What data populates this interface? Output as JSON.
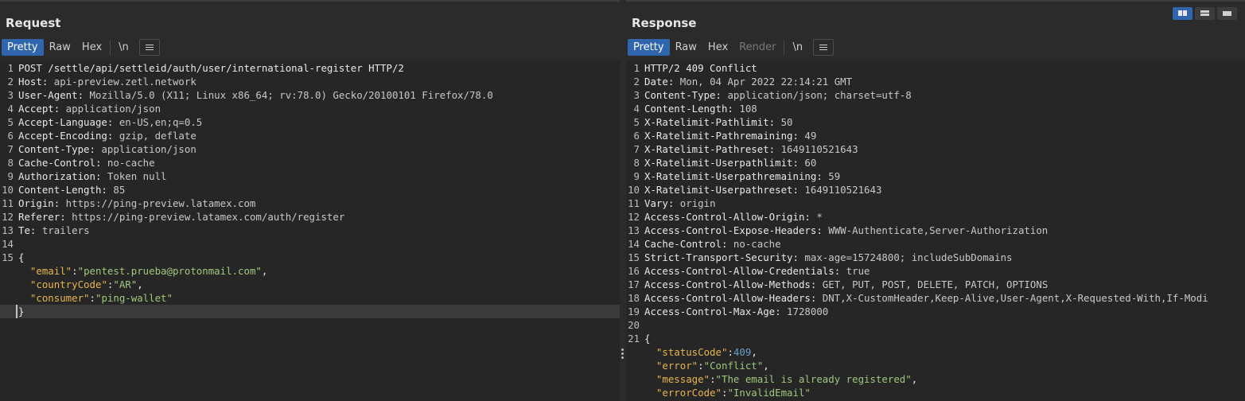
{
  "request": {
    "title": "Request",
    "tabs": [
      "Pretty",
      "Raw",
      "Hex"
    ],
    "newline_label": "\\n",
    "menu_icon": "hamburger-icon",
    "lines": [
      {
        "num": "1",
        "key": "POST /settle/api/settleid/auth/user/international-register HTTP/2",
        "val": ""
      },
      {
        "num": "2",
        "key": "Host:",
        "val": " api-preview.zetl.network"
      },
      {
        "num": "3",
        "key": "User-Agent:",
        "val": " Mozilla/5.0 (X11; Linux x86_64; rv:78.0) Gecko/20100101 Firefox/78.0"
      },
      {
        "num": "4",
        "key": "Accept:",
        "val": " application/json"
      },
      {
        "num": "5",
        "key": "Accept-Language:",
        "val": " en-US,en;q=0.5"
      },
      {
        "num": "6",
        "key": "Accept-Encoding:",
        "val": " gzip, deflate"
      },
      {
        "num": "7",
        "key": "Content-Type:",
        "val": " application/json"
      },
      {
        "num": "8",
        "key": "Cache-Control:",
        "val": " no-cache"
      },
      {
        "num": "9",
        "key": "Authorization:",
        "val": " Token null"
      },
      {
        "num": "10",
        "key": "Content-Length:",
        "val": " 85"
      },
      {
        "num": "11",
        "key": "Origin:",
        "val": " https://ping-preview.latamex.com"
      },
      {
        "num": "12",
        "key": "Referer:",
        "val": " https://ping-preview.latamex.com/auth/register"
      },
      {
        "num": "13",
        "key": "Te:",
        "val": " trailers"
      },
      {
        "num": "14",
        "key": "",
        "val": ""
      },
      {
        "num": "15",
        "key": "{",
        "val": ""
      },
      {
        "num": "",
        "json_key": "\"email\"",
        "json_val": "\"pentest.prueba@protonmail.com\"",
        "json_kind": "str",
        "tail": ","
      },
      {
        "num": "",
        "json_key": "\"countryCode\"",
        "json_val": "\"AR\"",
        "json_kind": "str",
        "tail": ","
      },
      {
        "num": "",
        "json_key": "\"consumer\"",
        "json_val": "\"ping-wallet\"",
        "json_kind": "str",
        "tail": ""
      },
      {
        "num": "",
        "key": "}",
        "val": "",
        "current": true
      }
    ]
  },
  "response": {
    "title": "Response",
    "tabs": [
      "Pretty",
      "Raw",
      "Hex",
      "Render"
    ],
    "newline_label": "\\n",
    "menu_icon": "hamburger-icon",
    "lines": [
      {
        "num": "1",
        "key": "HTTP/2 409 Conflict",
        "val": ""
      },
      {
        "num": "2",
        "key": "Date:",
        "val": " Mon, 04 Apr 2022 22:14:21 GMT"
      },
      {
        "num": "3",
        "key": "Content-Type:",
        "val": " application/json; charset=utf-8"
      },
      {
        "num": "4",
        "key": "Content-Length:",
        "val": " 108"
      },
      {
        "num": "5",
        "key": "X-Ratelimit-Pathlimit:",
        "val": " 50"
      },
      {
        "num": "6",
        "key": "X-Ratelimit-Pathremaining:",
        "val": " 49"
      },
      {
        "num": "7",
        "key": "X-Ratelimit-Pathreset:",
        "val": " 1649110521643"
      },
      {
        "num": "8",
        "key": "X-Ratelimit-Userpathlimit:",
        "val": " 60"
      },
      {
        "num": "9",
        "key": "X-Ratelimit-Userpathremaining:",
        "val": " 59"
      },
      {
        "num": "10",
        "key": "X-Ratelimit-Userpathreset:",
        "val": " 1649110521643"
      },
      {
        "num": "11",
        "key": "Vary:",
        "val": " origin"
      },
      {
        "num": "12",
        "key": "Access-Control-Allow-Origin:",
        "val": " *"
      },
      {
        "num": "13",
        "key": "Access-Control-Expose-Headers:",
        "val": " WWW-Authenticate,Server-Authorization"
      },
      {
        "num": "14",
        "key": "Cache-Control:",
        "val": " no-cache"
      },
      {
        "num": "15",
        "key": "Strict-Transport-Security:",
        "val": " max-age=15724800; includeSubDomains"
      },
      {
        "num": "16",
        "key": "Access-Control-Allow-Credentials:",
        "val": " true"
      },
      {
        "num": "17",
        "key": "Access-Control-Allow-Methods:",
        "val": " GET, PUT, POST, DELETE, PATCH, OPTIONS"
      },
      {
        "num": "18",
        "key": "Access-Control-Allow-Headers:",
        "val": " DNT,X-CustomHeader,Keep-Alive,User-Agent,X-Requested-With,If-Modi"
      },
      {
        "num": "19",
        "key": "Access-Control-Max-Age:",
        "val": " 1728000"
      },
      {
        "num": "20",
        "key": "",
        "val": ""
      },
      {
        "num": "21",
        "key": "{",
        "val": ""
      },
      {
        "num": "",
        "json_key": "\"statusCode\"",
        "json_val": "409",
        "json_kind": "num",
        "tail": ","
      },
      {
        "num": "",
        "json_key": "\"error\"",
        "json_val": "\"Conflict\"",
        "json_kind": "str",
        "tail": ","
      },
      {
        "num": "",
        "json_key": "\"message\"",
        "json_val": "\"The email is already registered\"",
        "json_kind": "str",
        "tail": ","
      },
      {
        "num": "",
        "json_key": "\"errorCode\"",
        "json_val": "\"InvalidEmail\"",
        "json_kind": "str",
        "tail": ""
      }
    ]
  },
  "layout_toggles": [
    {
      "name": "side-by-side-view-icon",
      "active": true
    },
    {
      "name": "stacked-view-icon",
      "active": false
    },
    {
      "name": "single-view-icon",
      "active": false
    }
  ]
}
